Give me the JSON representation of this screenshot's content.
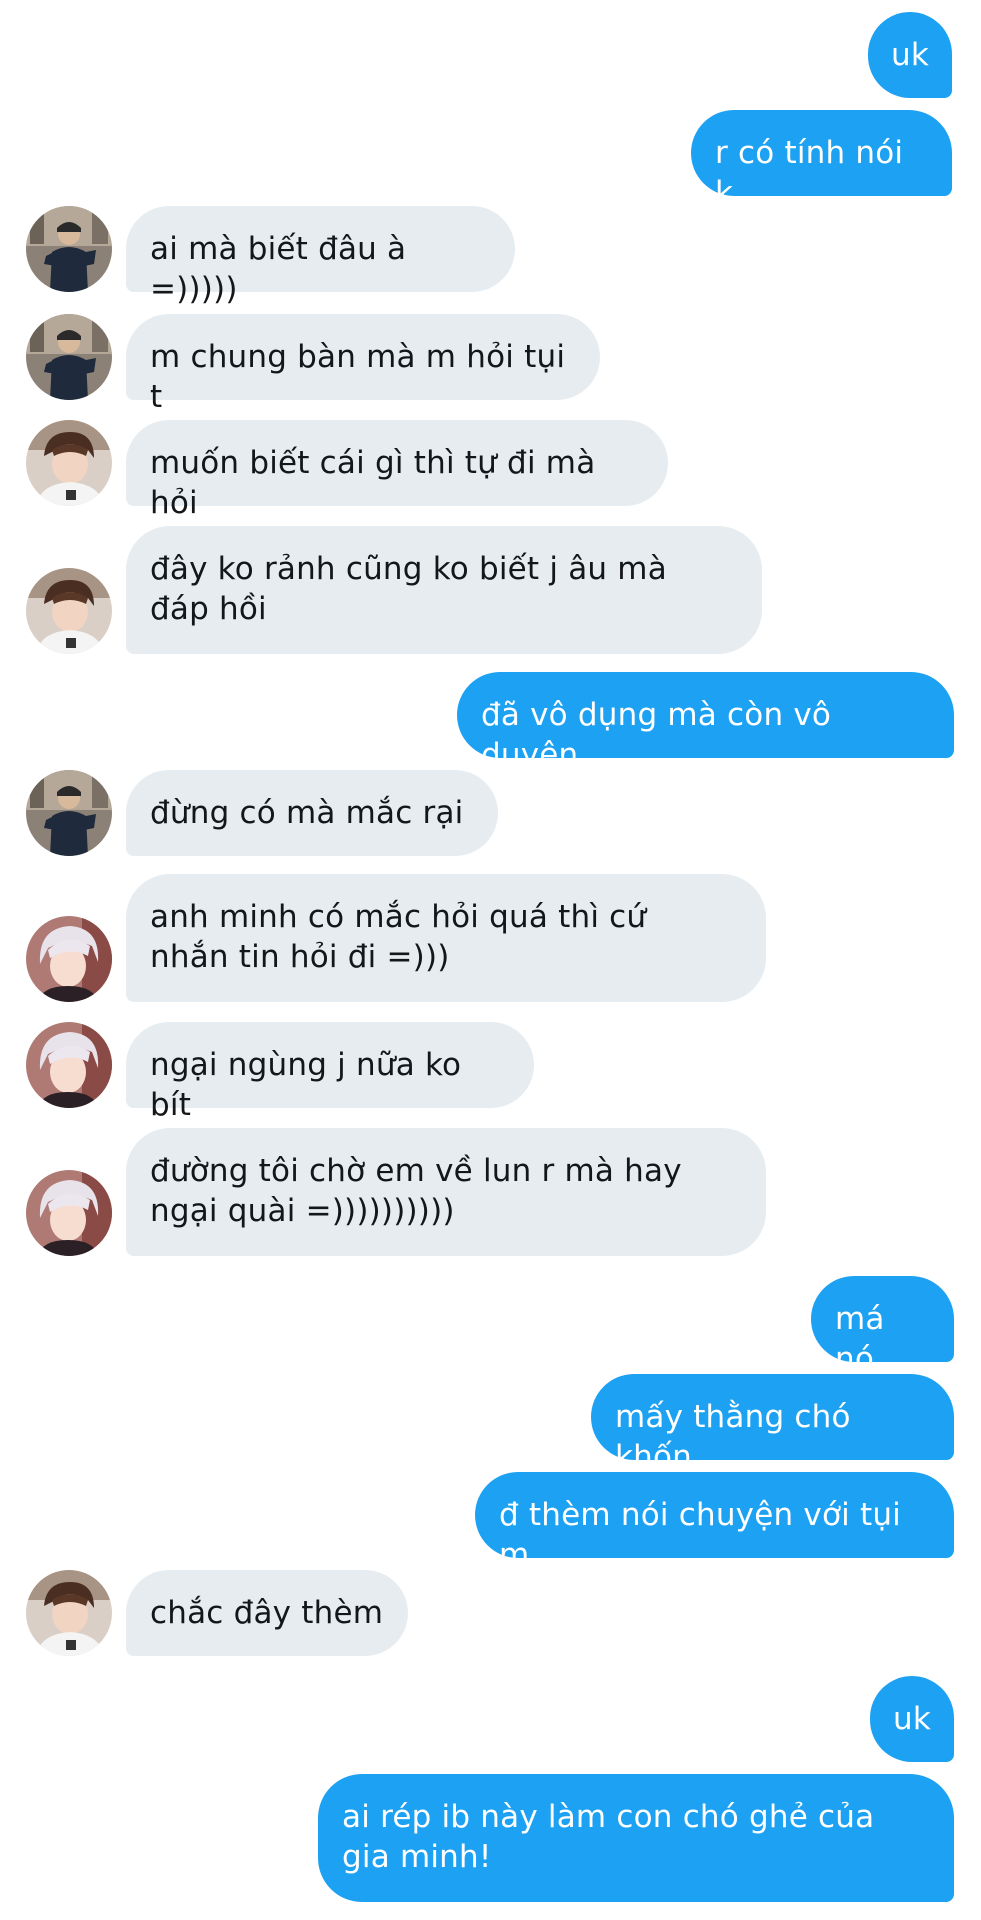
{
  "conversation": {
    "messages": [
      {
        "side": "out",
        "text": "uk"
      },
      {
        "side": "out",
        "text": "r có tính nói k"
      },
      {
        "side": "in",
        "sender": "friend-a",
        "text": "ai mà biết đâu à =)))))"
      },
      {
        "side": "in",
        "sender": "friend-a",
        "text": "m chung bàn mà m hỏi tụi t"
      },
      {
        "side": "in",
        "sender": "friend-b",
        "text": "muốn biết cái gì thì tự đi mà hỏi"
      },
      {
        "side": "in",
        "sender": "friend-b",
        "text": "đây ko rảnh cũng ko biết j âu mà đáp hồi"
      },
      {
        "side": "out",
        "text": "đã vô dụng mà còn vô duyên"
      },
      {
        "side": "in",
        "sender": "friend-a",
        "text": "đừng có mà mắc rại"
      },
      {
        "side": "in",
        "sender": "friend-c",
        "text": "anh minh có mắc hỏi quá thì cứ nhắn tin hỏi đi =)))"
      },
      {
        "side": "in",
        "sender": "friend-c",
        "text": "ngại ngùng j nữa ko bít"
      },
      {
        "side": "in",
        "sender": "friend-c",
        "text": "đường tôi chờ em về lun r mà hay ngại quài =))))))))))"
      },
      {
        "side": "out",
        "text": "má nó"
      },
      {
        "side": "out",
        "text": "mấy thằng chó khốn"
      },
      {
        "side": "out",
        "text": "đ thèm nói chuyện với tụi m"
      },
      {
        "side": "in",
        "sender": "friend-b",
        "text": "chắc đây thèm"
      },
      {
        "side": "out",
        "text": "uk"
      },
      {
        "side": "out",
        "text": "ai rép ib này làm con chó ghẻ của gia minh!"
      }
    ]
  },
  "colors": {
    "outgoing_bubble": "#1da1f2",
    "incoming_bubble": "#e6ecf0",
    "incoming_text": "#14171a",
    "outgoing_text": "#ffffff",
    "background": "#ffffff"
  }
}
